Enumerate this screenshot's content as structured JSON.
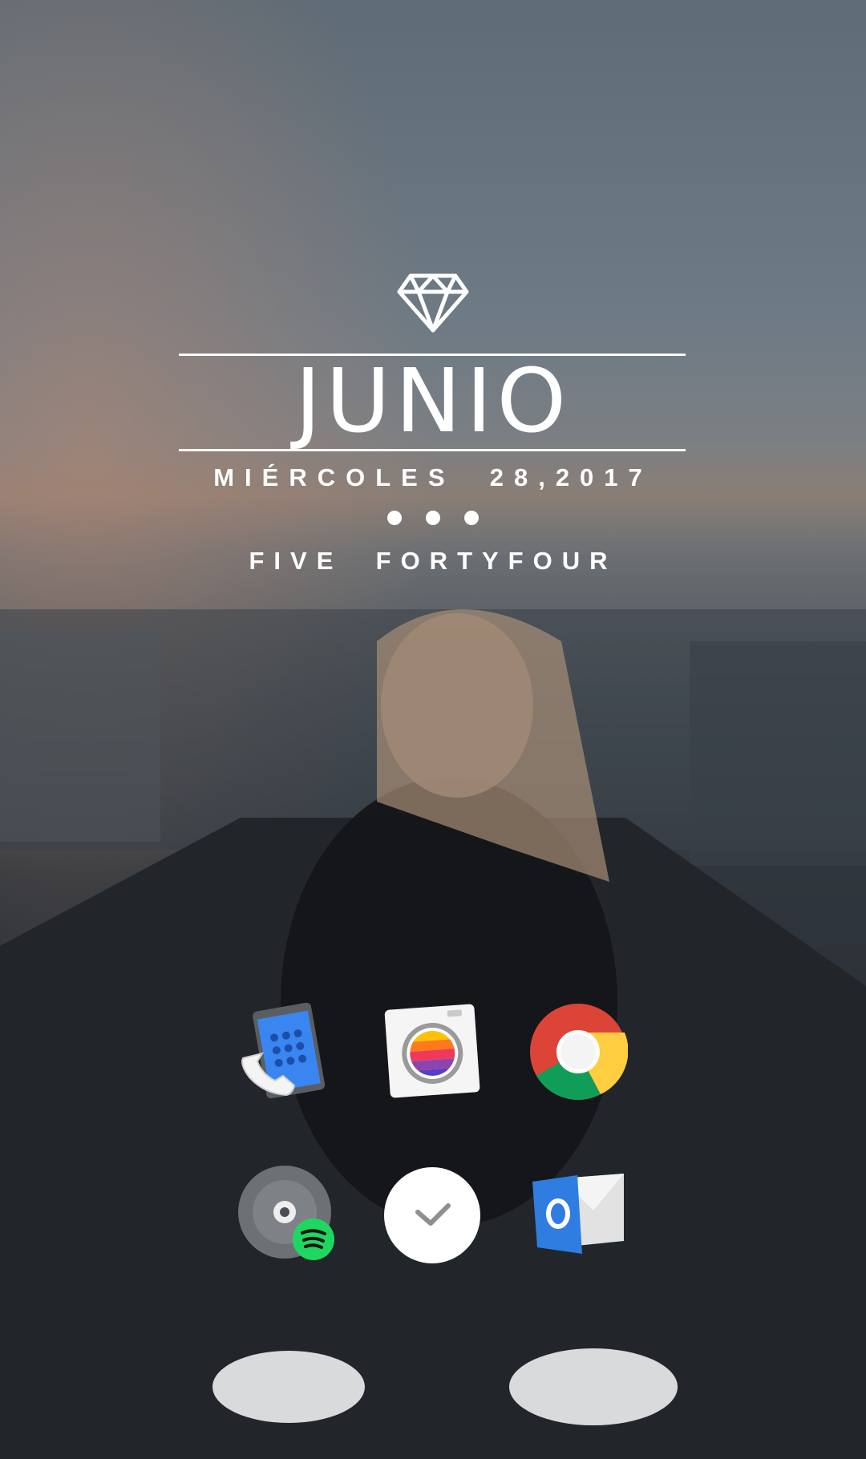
{
  "widget": {
    "icon": "diamond-icon",
    "month": "JUNIO",
    "date": "MIÉRCOLES  28,2017",
    "time": "FIVE  FORTYFOUR"
  },
  "dock": [
    {
      "id": "phone",
      "icon": "phone-dialer-icon"
    },
    {
      "id": "camera",
      "icon": "camera-icon"
    },
    {
      "id": "browser",
      "icon": "chrome-icon"
    },
    {
      "id": "music",
      "icon": "spotify-icon"
    },
    {
      "id": "tasks",
      "icon": "checkmark-icon"
    },
    {
      "id": "mail",
      "icon": "outlook-icon"
    }
  ],
  "colors": {
    "sky": "#5d6872",
    "ground": "#24272d",
    "accent_blue": "#2f7de1",
    "spotify_green": "#1ed760"
  }
}
